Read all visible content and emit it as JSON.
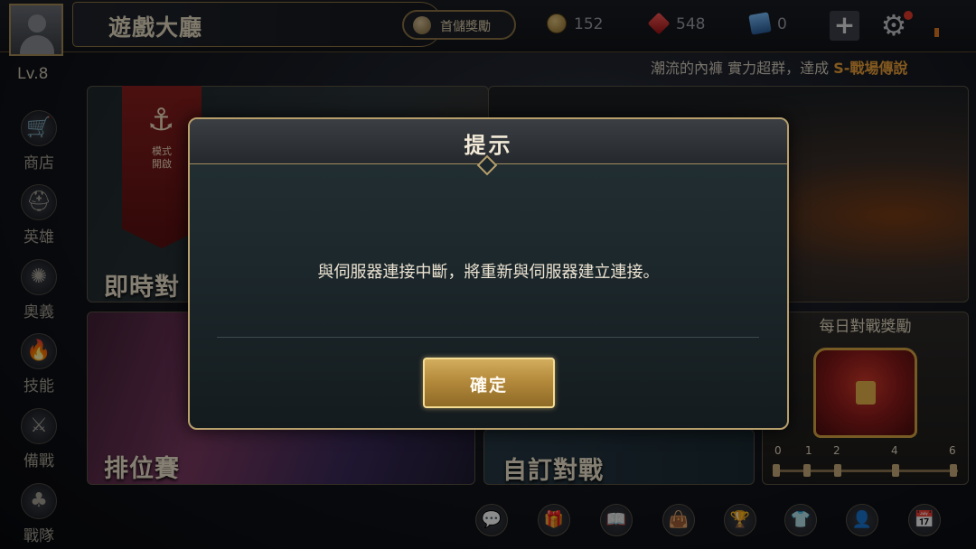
{
  "header": {
    "title": "遊戲大廳",
    "first_recharge_label": "首儲獎勵",
    "currencies": [
      {
        "icon": "coin-icon",
        "value": "152"
      },
      {
        "icon": "ruby-icon",
        "value": "548"
      },
      {
        "icon": "card-icon",
        "value": "0"
      }
    ],
    "plus_label": "+",
    "settings_icon": "gear-icon"
  },
  "marquee": {
    "prefix": "潮流的內褲 實力超群，達成 ",
    "highlight": "S-戰場傳說"
  },
  "player": {
    "level": "Lv.8"
  },
  "sidebar": {
    "items": [
      {
        "label": "商店",
        "icon": "shop-cart-icon"
      },
      {
        "label": "英雄",
        "icon": "helmet-icon"
      },
      {
        "label": "奧義",
        "icon": "rune-icon"
      },
      {
        "label": "技能",
        "icon": "flame-icon"
      },
      {
        "label": "備戰",
        "icon": "sword-shield-icon"
      },
      {
        "label": "戰隊",
        "icon": "clan-tree-icon"
      }
    ]
  },
  "modes": {
    "banner_text": "模式\n開啟",
    "realtime": "即時對",
    "ranked": "排位賽",
    "custom": "自訂對戰",
    "daily_reward_title": "每日對戰獎勵",
    "daily_progress_marks": [
      "0",
      "1",
      "2",
      "4",
      "6"
    ]
  },
  "toolbar": {
    "icons": [
      "chat-icon",
      "gift-icon",
      "book-icon",
      "bag-icon",
      "trophy-icon",
      "shirt-icon",
      "friend-icon",
      "calendar-icon"
    ]
  },
  "dialog": {
    "title": "提示",
    "message": "與伺服器連接中斷，將重新與伺服器建立連接。",
    "confirm_label": "確定"
  },
  "colors": {
    "accent_gold": "#b79f6c",
    "confirm_button": "#b48a3c",
    "highlight_orange": "#f0a33a"
  }
}
